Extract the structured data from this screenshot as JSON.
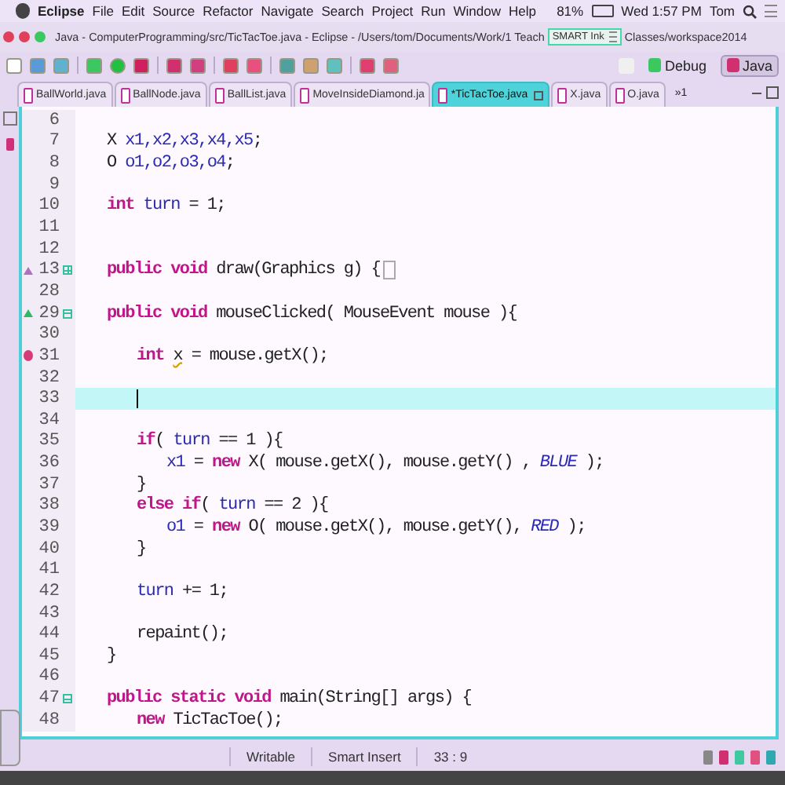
{
  "menu_bar": {
    "app": "Eclipse",
    "items": [
      "File",
      "Edit",
      "Source",
      "Refactor",
      "Navigate",
      "Search",
      "Project",
      "Run",
      "Window",
      "Help"
    ],
    "battery": "81%",
    "clock": "Wed 1:57 PM",
    "user": "Tom"
  },
  "window": {
    "title_start": "Java - ComputerProgramming/src/TicTacToe.java - Eclipse - /Users/tom/Documents/Work/1 Teach",
    "overlay": "SMART Ink",
    "title_end": "Classes/workspace2014"
  },
  "perspectives": [
    {
      "label": "Debug",
      "selected": false
    },
    {
      "label": "Java",
      "selected": true
    }
  ],
  "tabs": [
    {
      "label": "BallWorld.java",
      "selected": false
    },
    {
      "label": "BallNode.java",
      "selected": false
    },
    {
      "label": "BallList.java",
      "selected": false
    },
    {
      "label": "MoveInsideDiamond.ja",
      "selected": false
    },
    {
      "label": "*TicTacToe.java",
      "selected": true
    },
    {
      "label": "X.java",
      "selected": false
    },
    {
      "label": "O.java",
      "selected": false
    }
  ],
  "tab_overflow": "»1",
  "lines": [
    {
      "n": "6",
      "current": false
    },
    {
      "n": "7",
      "current": false,
      "segs": [
        {
          "t": "X ",
          "kind": "plain"
        },
        {
          "t": "x1,x2,x3,x4,x5",
          "kind": "var"
        },
        {
          "t": ";",
          "kind": "plain"
        }
      ]
    },
    {
      "n": "8",
      "current": false,
      "segs": [
        {
          "t": "O ",
          "kind": "plain"
        },
        {
          "t": "o1,o2,o3,o4",
          "kind": "var"
        },
        {
          "t": ";",
          "kind": "plain"
        }
      ]
    },
    {
      "n": "9",
      "current": false
    },
    {
      "n": "10",
      "current": false,
      "segs": [
        {
          "t": "int ",
          "kind": "kw"
        },
        {
          "t": "turn",
          "kind": "var"
        },
        {
          "t": " = 1;",
          "kind": "plain"
        }
      ]
    },
    {
      "n": "11",
      "current": false
    },
    {
      "n": "12",
      "current": false
    },
    {
      "n": "13",
      "current": false,
      "markers": [
        {
          "kind": "override-hollow"
        },
        {
          "kind": "fold-collapsed"
        }
      ],
      "segs": [
        {
          "t": "public void",
          "kind": "kw"
        },
        {
          "t": " draw(Graphics g) {",
          "kind": "plain"
        }
      ]
    },
    {
      "n": "28",
      "current": false
    },
    {
      "n": "29",
      "current": false,
      "markers": [
        {
          "kind": "override"
        },
        {
          "kind": "fold-expanded"
        }
      ],
      "segs": [
        {
          "t": "public void",
          "kind": "kw"
        },
        {
          "t": " mouseClicked( MouseEvent mouse ){",
          "kind": "plain"
        }
      ],
      "children": [
        {
          "n": "30",
          "current": false
        },
        {
          "n": "31",
          "current": false,
          "markers": [
            {
              "kind": "warning"
            }
          ],
          "segs": [
            {
              "t": "int ",
              "kind": "kw"
            },
            {
              "t": "x",
              "kind": "warn"
            },
            {
              "t": " = mouse.getX();",
              "kind": "plain"
            }
          ]
        },
        {
          "n": "32",
          "current": false
        },
        {
          "n": "33",
          "current": true
        },
        {
          "n": "34",
          "current": false
        },
        {
          "n": "35",
          "current": false,
          "segs": [
            {
              "t": "if",
              "kind": "kw"
            },
            {
              "t": "( ",
              "kind": "plain"
            },
            {
              "t": "turn",
              "kind": "var"
            },
            {
              "t": " == 1 ){",
              "kind": "plain"
            }
          ],
          "children": [
            {
              "n": "36",
              "current": false,
              "segs": [
                {
                  "t": "x1",
                  "kind": "var"
                },
                {
                  "t": " = ",
                  "kind": "plain"
                },
                {
                  "t": "new",
                  "kind": "kw"
                },
                {
                  "t": " X( mouse.getX(), mouse.getY() , ",
                  "kind": "plain"
                },
                {
                  "t": "BLUE",
                  "kind": "const"
                },
                {
                  "t": " );",
                  "kind": "plain"
                }
              ]
            }
          ]
        },
        {
          "n": "37",
          "current": false,
          "segs": [
            {
              "t": "}",
              "kind": "plain"
            }
          ]
        },
        {
          "n": "38",
          "current": false,
          "segs": [
            {
              "t": "else if",
              "kind": "kw"
            },
            {
              "t": "( ",
              "kind": "plain"
            },
            {
              "t": "turn",
              "kind": "var"
            },
            {
              "t": " == 2 ){",
              "kind": "plain"
            }
          ],
          "children": [
            {
              "n": "39",
              "current": false,
              "segs": [
                {
                  "t": "o1",
                  "kind": "var"
                },
                {
                  "t": " = ",
                  "kind": "plain"
                },
                {
                  "t": "new",
                  "kind": "kw"
                },
                {
                  "t": " O( mouse.getX(), mouse.getY(), ",
                  "kind": "plain"
                },
                {
                  "t": "RED",
                  "kind": "const"
                },
                {
                  "t": " );",
                  "kind": "plain"
                }
              ]
            }
          ]
        },
        {
          "n": "40",
          "current": false,
          "segs": [
            {
              "t": "}",
              "kind": "plain"
            }
          ]
        },
        {
          "n": "41",
          "current": false
        },
        {
          "n": "42",
          "current": false,
          "segs": [
            {
              "t": "turn",
              "kind": "var"
            },
            {
              "t": " += 1;",
              "kind": "plain"
            }
          ]
        },
        {
          "n": "43",
          "current": false
        },
        {
          "n": "44",
          "current": false,
          "segs": [
            {
              "t": "repaint();",
              "kind": "plain"
            }
          ]
        }
      ]
    },
    {
      "n": "45",
      "current": false,
      "segs": [
        {
          "t": "}",
          "kind": "plain"
        }
      ]
    },
    {
      "n": "46",
      "current": false
    },
    {
      "n": "47",
      "current": false,
      "markers": [
        {
          "kind": "fold-expanded"
        }
      ],
      "segs": [
        {
          "t": "public static void",
          "kind": "kw"
        },
        {
          "t": " main(String[] args) {",
          "kind": "plain"
        }
      ],
      "children": [
        {
          "n": "48",
          "current": false,
          "segs": [
            {
              "t": "new",
              "kind": "kw"
            },
            {
              "t": " TicTacToe();",
              "kind": "plain"
            }
          ]
        }
      ]
    }
  ],
  "status_bar": {
    "mode": "Writable",
    "insert": "Smart Insert",
    "position": "33 : 9"
  }
}
